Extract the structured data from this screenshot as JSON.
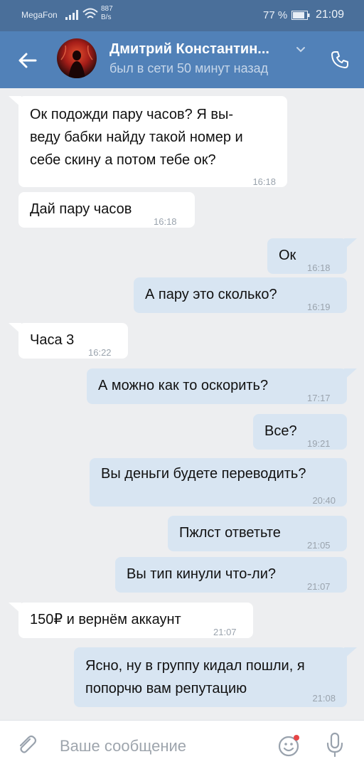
{
  "status_bar": {
    "carrier": "MegaFon",
    "speed_value": "887",
    "speed_unit": "B/s",
    "battery": "77 %",
    "time": "21:09"
  },
  "toolbar": {
    "title": "Дмитрий Константин...",
    "subtitle": "был в сети 50 минут назад",
    "back_icon": "arrow-left-icon",
    "call_icon": "phone-icon"
  },
  "messages": [
    {
      "dir": "in",
      "text": "Ок подожди пару часов? Я вы-\nведу бабки найду такой номер и\nсебе скину а потом тебе ок?",
      "time": "16:18"
    },
    {
      "dir": "in",
      "text": "Дай пару часов",
      "time": "16:18"
    },
    {
      "dir": "out",
      "text": "Ок",
      "time": "16:18"
    },
    {
      "dir": "out",
      "text": "А пару это сколько?",
      "time": "16:19"
    },
    {
      "dir": "in",
      "text": "Часа 3",
      "time": "16:22"
    },
    {
      "dir": "out",
      "text": "А можно как то оскорить?",
      "time": "17:17"
    },
    {
      "dir": "out",
      "text": "Все?",
      "time": "19:21"
    },
    {
      "dir": "out",
      "text": "Вы деньги будете переводить?",
      "time": "20:40"
    },
    {
      "dir": "out",
      "text": "Пжлст ответьте",
      "time": "21:05"
    },
    {
      "dir": "out",
      "text": "Вы тип кинули что-ли?",
      "time": "21:07"
    },
    {
      "dir": "in",
      "text": "150₽ и вернём аккаунт",
      "time": "21:07"
    },
    {
      "dir": "out",
      "text": "Ясно, ну в группу кидал пошли, я\nпопорчю вам репутацию",
      "time": "21:08"
    }
  ],
  "input": {
    "placeholder": "Ваше сообщение",
    "value": ""
  },
  "colors": {
    "status_bar": "#4a6f9a",
    "toolbar": "#5181b8",
    "incoming_bubble": "#ffffff",
    "outgoing_bubble": "#d8e5f2",
    "background": "#edeef0"
  }
}
